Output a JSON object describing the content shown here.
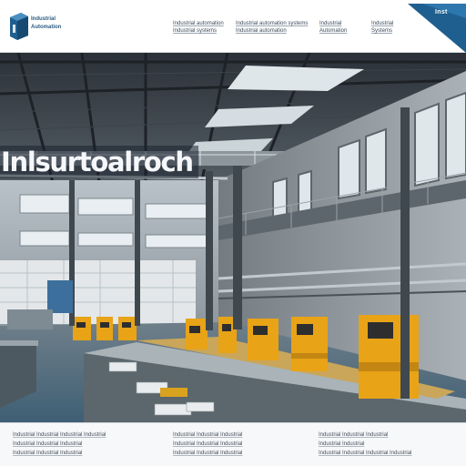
{
  "header": {
    "brand": {
      "line1": "Industrial",
      "line2": "Automation"
    },
    "nav": [
      {
        "line1": "Industrial automation",
        "line2": "Industrial systems"
      },
      {
        "line1": "Industrial automation systems",
        "line2": "Industrial automation"
      },
      {
        "line1": "Industrial",
        "line2": "Automation"
      },
      {
        "line1": "Industrial",
        "line2": "Systems"
      }
    ],
    "corner_label": "Inst"
  },
  "hero": {
    "title": "Inlsurtoalroch"
  },
  "footer": {
    "columns": [
      {
        "lines": [
          "Industrial Industrial Industrial Industrial",
          "Industrial Industrial Industrial",
          "Industrial Industrial Industrial"
        ]
      },
      {
        "lines": [
          "Industrial Industrial Industrial",
          "Industrial Industrial Industrial",
          "Industrial Industrial Industrial"
        ]
      },
      {
        "lines": [
          "Industrial Industrial Industrial",
          "Industrial Industrial",
          "Industrial Industrial Industrial Industrial"
        ]
      }
    ]
  },
  "colors": {
    "accent": "#1f5f8f",
    "machine_yellow": "#e8a317",
    "header_bg": "#ffffff"
  }
}
